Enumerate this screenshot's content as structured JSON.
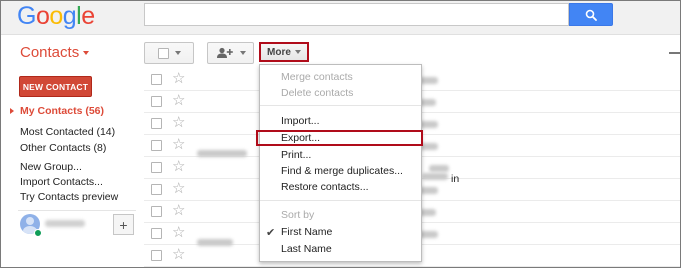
{
  "logo": {
    "letters": [
      {
        "ch": "G",
        "color": "#4285F4"
      },
      {
        "ch": "o",
        "color": "#EA4335"
      },
      {
        "ch": "o",
        "color": "#FBBC05"
      },
      {
        "ch": "g",
        "color": "#4285F4"
      },
      {
        "ch": "l",
        "color": "#34A853"
      },
      {
        "ch": "e",
        "color": "#EA4335"
      }
    ]
  },
  "search": {
    "value": "",
    "placeholder": "",
    "icon": "search-icon"
  },
  "app": {
    "title": "Contacts"
  },
  "toolbar": {
    "select_icon": "checkbox-icon",
    "add_person_icon": "add-person-icon",
    "more_label": "More"
  },
  "sidebar": {
    "new_contact": "NEW CONTACT",
    "items": [
      {
        "label": "My Contacts (56)",
        "active": true
      },
      {
        "label": "Most Contacted (14)",
        "active": false
      },
      {
        "label": "Other Contacts (8)",
        "active": false
      },
      {
        "label": "New Group...",
        "active": false
      },
      {
        "label": "Import Contacts...",
        "active": false
      },
      {
        "label": "Try Contacts preview",
        "active": false
      }
    ],
    "add_chat": "+"
  },
  "list": {
    "row_count": 9,
    "visible_suffix": "in"
  },
  "menu": {
    "group1": [
      "Merge contacts",
      "Delete contacts"
    ],
    "group2": [
      "Import...",
      "Export...",
      "Print...",
      "Find & merge duplicates...",
      "Restore contacts..."
    ],
    "sort_header": "Sort by",
    "sort_options": [
      {
        "label": "First Name",
        "selected": true
      },
      {
        "label": "Last Name",
        "selected": false
      }
    ],
    "check_glyph": "✔"
  },
  "colors": {
    "accent_red": "#dd4b39",
    "new_contact_bg": "#d14836",
    "highlight_box": "#b00c1a",
    "search_blue": "#4285f4",
    "online_green": "#0f9d58"
  }
}
